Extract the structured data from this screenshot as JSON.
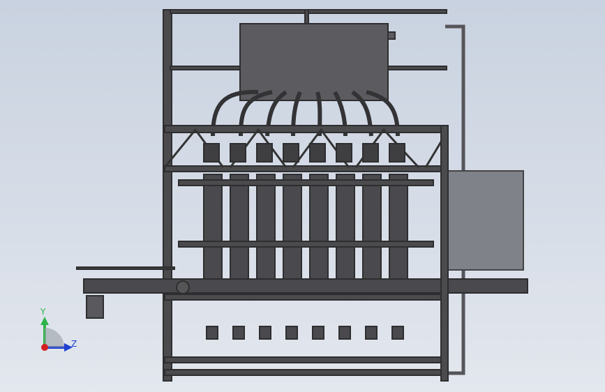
{
  "viewport": {
    "background_top": "#c9d2e0",
    "background_bottom": "#e3e7ee"
  },
  "model": {
    "frame_color": "#3a3a3c",
    "tank_color": "#58585c",
    "cylinder_color": "#4a4a4e",
    "panel_color": "#7e8088",
    "nozzle_count": 8
  },
  "triad": {
    "y_label": "Y",
    "z_label": "Z",
    "y_color": "#2fb34a",
    "z_color": "#1f3fd1",
    "origin_color": "#d42020"
  }
}
